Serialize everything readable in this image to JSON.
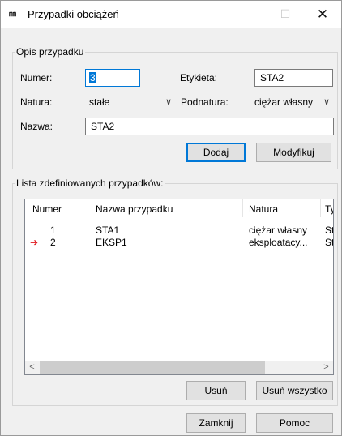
{
  "window": {
    "title": "Przypadki obciążeń",
    "app_icon_text": "㎜",
    "minimize": "—",
    "maximize": "☐",
    "close": "✕"
  },
  "description_group": {
    "legend": "Opis przypadku",
    "number_label": "Numer:",
    "number_value": "3",
    "label_label": "Etykieta:",
    "label_value": "STA2",
    "nature_label": "Natura:",
    "nature_value": "stałe",
    "subnature_label": "Podnatura:",
    "subnature_value": "ciężar własny",
    "name_label": "Nazwa:",
    "name_value": "STA2",
    "add_button": "Dodaj",
    "modify_button": "Modyfikuj"
  },
  "list_group": {
    "legend": "Lista zdefiniowanych przypadków:",
    "columns": [
      "Numer",
      "Nazwa przypadku",
      "Natura",
      "Ty"
    ],
    "rows": [
      {
        "number": "1",
        "name": "STA1",
        "nature": "ciężar własny",
        "type": "St",
        "current": false
      },
      {
        "number": "2",
        "name": "EKSP1",
        "nature": "eksploatacy...",
        "type": "St",
        "current": true
      }
    ],
    "scroll_left": "<",
    "scroll_right": ">",
    "delete_button": "Usuń",
    "delete_all_button": "Usuń wszystko"
  },
  "footer": {
    "close_button": "Zamknij",
    "help_button": "Pomoc"
  },
  "colors": {
    "accent": "#0078d7",
    "arrow": "#e0161c"
  },
  "icons": {
    "current_row": "arrow-right-icon"
  }
}
